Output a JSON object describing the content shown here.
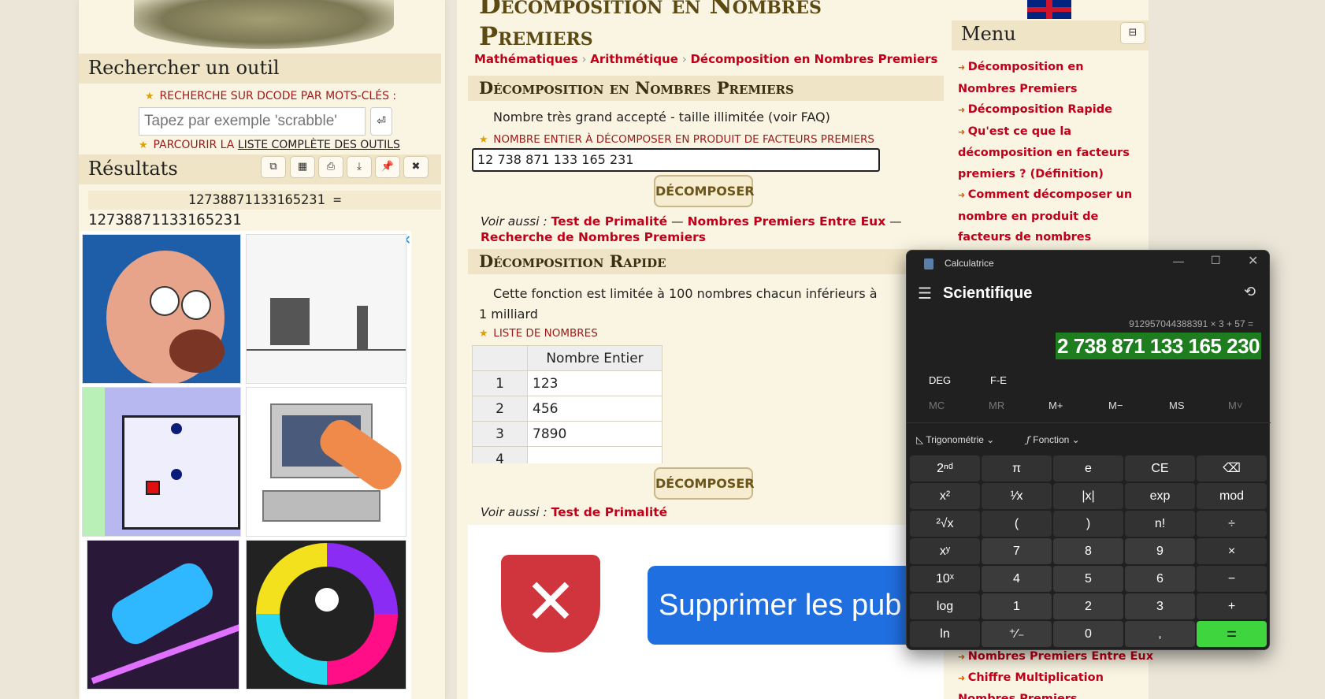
{
  "left": {
    "search_title": "Rechercher un outil",
    "keyword_label": "Recherche sur dCode par mots-clés :",
    "search_placeholder": "Tapez par exemple 'scrabble'",
    "browse_prefix": "Parcourir la ",
    "browse_link": "liste complète des outils",
    "results_title": "Résultats",
    "result_line1": "12738871133165231 =",
    "result_line2": "12738871133165231"
  },
  "center": {
    "page_title_line1": "Décomposition en Nombres",
    "page_title_line2": "Premiers",
    "breadcrumb": [
      "Mathématiques",
      "Arithmétique",
      "Décomposition en Nombres Premiers"
    ],
    "section1_title": "Décomposition en Nombres Premiers",
    "section1_note": "Nombre très grand accepté - taille illimitée (voir FAQ)",
    "section1_label": "Nombre entier à décomposer en produit de facteurs premiers",
    "number_value": "12 738 871 133 165 231",
    "decompose_label": "DÉCOMPOSER",
    "see_also_label": "Voir aussi :",
    "see_also1": [
      "Test de Primalité",
      "Nombres Premiers Entre Eux",
      "Recherche de Nombres Premiers"
    ],
    "section2_title": "Décomposition Rapide",
    "section2_note": "Cette fonction est limitée à 100 nombres chacun inférieurs à 1 milliard",
    "section2_label": "Liste de nombres",
    "table_header": "Nombre Entier",
    "table_rows": [
      {
        "idx": "1",
        "val": "123"
      },
      {
        "idx": "2",
        "val": "456"
      },
      {
        "idx": "3",
        "val": "7890"
      },
      {
        "idx": "4",
        "val": ""
      }
    ],
    "see_also2": "Test de Primalité",
    "ad_text": "Supprimer les pub"
  },
  "right": {
    "menu_title": "Menu",
    "menu_items": [
      "Décomposition en Nombres Premiers",
      "Décomposition Rapide",
      "Qu'est ce que la décomposition en facteurs premiers ? (Définition)",
      "Comment décomposer un nombre en produit de facteurs de nombres premiers ?"
    ],
    "bottom_items": [
      "Nombres Premiers Entre Eux",
      "Chiffre Multiplication",
      "Nombres Premiers"
    ]
  },
  "calculator": {
    "app_title": "Calculatrice",
    "mode": "Scientifique",
    "expression": "912957044388391 × 3 + 57 =",
    "display": "2 738 871 133 165 230",
    "deg": "DEG",
    "fe": "F-E",
    "memory": [
      "MC",
      "MR",
      "M+",
      "M−",
      "MS",
      "M˅"
    ],
    "trig": "Trigonométrie",
    "func": "Fonction",
    "keys": [
      [
        "2ⁿᵈ",
        "π",
        "e",
        "CE",
        "⌫"
      ],
      [
        "x²",
        "¹⁄x",
        "|x|",
        "exp",
        "mod"
      ],
      [
        "²√x",
        "(",
        ")",
        "n!",
        "÷"
      ],
      [
        "xʸ",
        "7",
        "8",
        "9",
        "×"
      ],
      [
        "10ˣ",
        "4",
        "5",
        "6",
        "−"
      ],
      [
        "log",
        "1",
        "2",
        "3",
        "+"
      ],
      [
        "ln",
        "⁺∕₋",
        "0",
        ",",
        "="
      ]
    ]
  },
  "colors": {
    "accent_red": "#c0001a",
    "calc_equal": "#3fd53f",
    "display_highlight": "#1e7d1e"
  }
}
